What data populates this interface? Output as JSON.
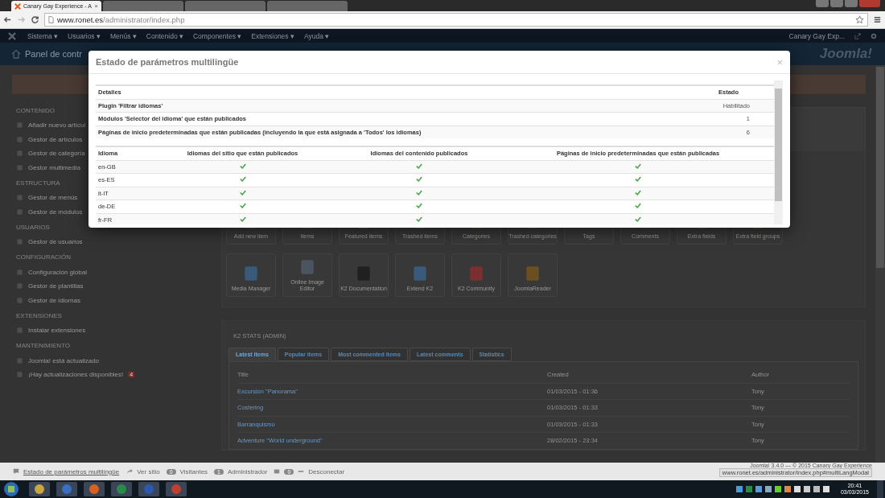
{
  "browser": {
    "tab_title": "Canary Gay Experience - A",
    "tab_close": "×",
    "url_host": "www.ronet.es",
    "url_path": "/administrator/index.php",
    "status_url": "www.ronet.es/administrator/index.php#multiLangModal"
  },
  "browser_tabs": [
    {
      "selected": true
    },
    {
      "selected": false
    },
    {
      "selected": false
    },
    {
      "selected": false
    }
  ],
  "menu": [
    {
      "label": "Sistema",
      "caret": "▾"
    },
    {
      "label": "Usuarios",
      "caret": "▾"
    },
    {
      "label": "Menús",
      "caret": "▾"
    },
    {
      "label": "Contenido",
      "caret": "▾"
    },
    {
      "label": "Componentes",
      "caret": "▾"
    },
    {
      "label": "Extensiones",
      "caret": "▾"
    },
    {
      "label": "Ayuda",
      "caret": "▾"
    }
  ],
  "account": "Canary Gay Exp...",
  "header": {
    "title": "Panel de contr",
    "logo": "Joomla!"
  },
  "sidebar": [
    {
      "title": "CONTENIDO",
      "items": [
        {
          "label": "Añadir nuevo artícul"
        },
        {
          "label": "Gestor de artículos"
        },
        {
          "label": "Gestor de categoría"
        },
        {
          "label": "Gestor multimedia"
        }
      ]
    },
    {
      "title": "ESTRUCTURA",
      "items": [
        {
          "label": "Gestor de menús"
        },
        {
          "label": "Gestor de módulos"
        }
      ]
    },
    {
      "title": "USUARIOS",
      "items": [
        {
          "label": "Gestor de usuarios"
        }
      ]
    },
    {
      "title": "CONFIGURACIÓN",
      "items": [
        {
          "label": "Configuración global"
        },
        {
          "label": "Gestor de plantillas"
        },
        {
          "label": "Gestor de idiomas"
        }
      ]
    },
    {
      "title": "EXTENSIONES",
      "items": [
        {
          "label": "Instalar extensiones"
        }
      ]
    },
    {
      "title": "MANTENIMIENTO",
      "items": [
        {
          "label": "Joomla! está actualizado"
        },
        {
          "label": "¡Hay actualizaciones disponibles!",
          "badge": "4"
        }
      ]
    }
  ],
  "quickicons": [
    [
      "Add new item",
      "Items",
      "Featured items",
      "Trashed items",
      "Categories",
      "Trashed categories",
      "Tags",
      "Comments",
      "Extra fields",
      "Extra field groups"
    ],
    [
      "Media Manager",
      "Online Image Editor",
      "K2 Documentation",
      "Extend K2",
      "K2 Community",
      "JoomlaReader"
    ]
  ],
  "k2_stats": {
    "title": "K2 STATS (ADMIN)",
    "tabs": [
      {
        "label": "Latest items",
        "selected": true
      },
      {
        "label": "Popular items",
        "selected": false
      },
      {
        "label": "Most commented items",
        "selected": false
      },
      {
        "label": "Latest comments",
        "selected": false
      },
      {
        "label": "Statistics",
        "selected": false
      }
    ],
    "columns": [
      "Title",
      "Created",
      "Author"
    ],
    "rows": [
      {
        "title": "Excursión \"Panorama\"",
        "created": "01/03/2015 - 01:36",
        "author": "Tony"
      },
      {
        "title": "Costering",
        "created": "01/03/2015 - 01:33",
        "author": "Tony"
      },
      {
        "title": "Barranquismo",
        "created": "01/03/2015 - 01:33",
        "author": "Tony"
      },
      {
        "title": "Adventure \"World underground\"",
        "created": "28/02/2015 - 23:34",
        "author": "Tony"
      }
    ]
  },
  "modal": {
    "title": "Estado de parámetros multilingüe",
    "close": "×",
    "details_columns": [
      "Detalles",
      "Estado"
    ],
    "details": [
      {
        "label": "Plugin 'Filtrar idiomas'",
        "value": "Habilitado"
      },
      {
        "label": "Módulos 'Selector del idioma' que están publicados",
        "value": "1"
      },
      {
        "label": "Páginas de inicio predeterminadas que están publicadas (incluyendo la que está asignada a 'Todos' los idiomas)",
        "value": "6"
      }
    ],
    "language_columns": [
      "Idioma",
      "Idiomas del sitio que están publicados",
      "Idiomas del contenido publicados",
      "Páginas de inicio predeterminadas que están publicadas"
    ],
    "languages": [
      {
        "code": "en-GB",
        "site": true,
        "content": true,
        "home": true
      },
      {
        "code": "es-ES",
        "site": true,
        "content": true,
        "home": true
      },
      {
        "code": "it-IT",
        "site": true,
        "content": true,
        "home": true
      },
      {
        "code": "de-DE",
        "site": true,
        "content": true,
        "home": true
      },
      {
        "code": "fr-FR",
        "site": true,
        "content": true,
        "home": true
      }
    ]
  },
  "footer": {
    "modal_link": "Estado de parámetros multilingüe",
    "site_link": "Ver sitio",
    "visitors_count": "0",
    "visitors_label": "Visitantes",
    "admin_count": "1",
    "admin_label": "Administrador",
    "messages_count": "0",
    "logout": "Desconectar",
    "copyright": "Joomla! 3.4.0 — © 2015 Canary Gay Experience"
  },
  "taskbar": {
    "time": "20:41",
    "date": "03/03/2015"
  }
}
